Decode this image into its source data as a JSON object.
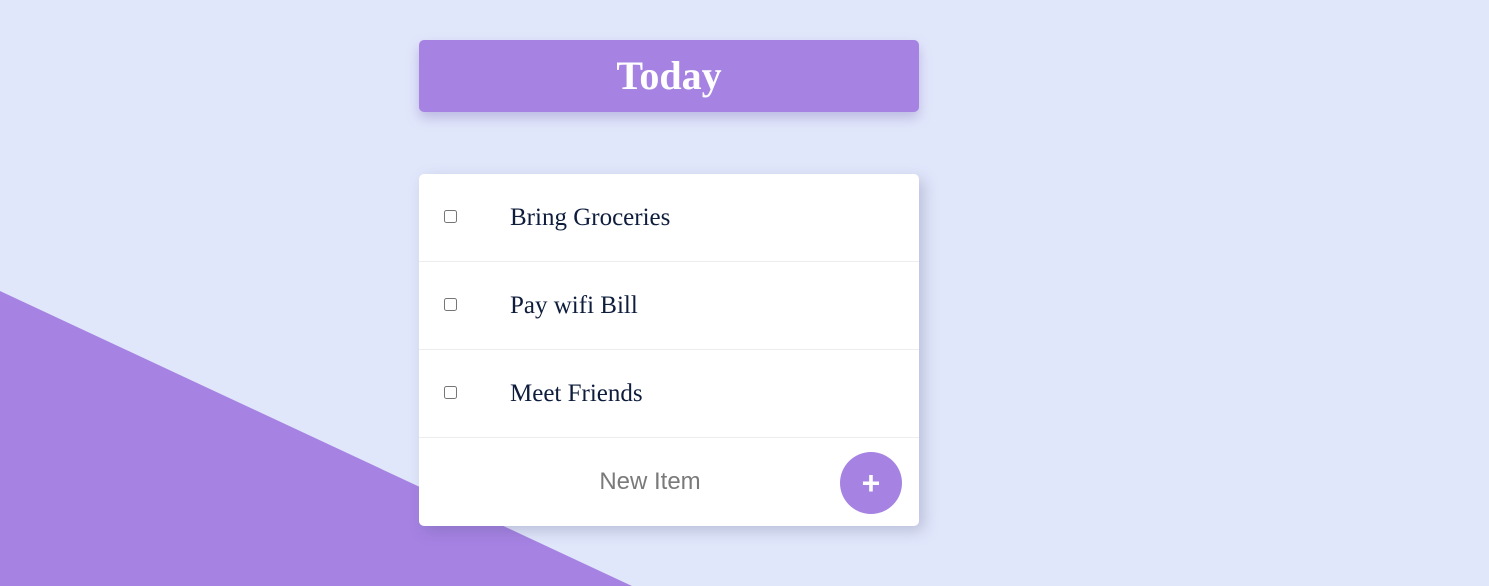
{
  "header": {
    "title": "Today"
  },
  "todo_list": {
    "items": [
      {
        "label": "Bring Groceries",
        "checked": false
      },
      {
        "label": "Pay wifi Bill",
        "checked": false
      },
      {
        "label": "Meet Friends",
        "checked": false
      }
    ],
    "new_item": {
      "placeholder": "New Item",
      "value": ""
    },
    "add_button_label": "+"
  },
  "colors": {
    "background": "#e1e7fb",
    "accent": "#a683e3",
    "text": "#0f1d3c"
  }
}
